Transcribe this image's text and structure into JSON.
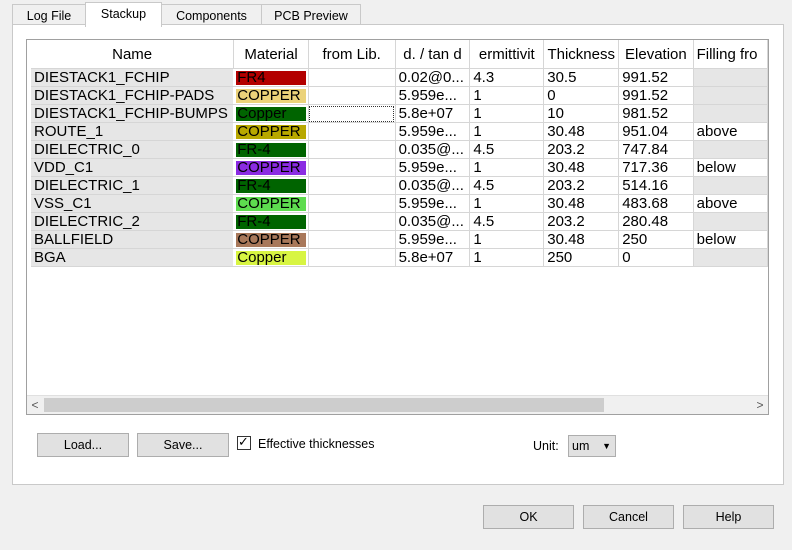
{
  "tabs": [
    {
      "label": "Log File",
      "active": false
    },
    {
      "label": "Stackup",
      "active": true
    },
    {
      "label": "Components",
      "active": false
    },
    {
      "label": "PCB Preview",
      "active": false
    }
  ],
  "grid": {
    "columns": [
      "Name",
      "Material",
      "from Lib.",
      "d. / tan d",
      "ermittivit",
      "Thickness",
      "Elevation",
      "Filling fro"
    ],
    "rows": [
      {
        "name": "DIESTACK1_FCHIP",
        "material": "FR4",
        "material_bg": "#b30000",
        "material_fg": "#000000",
        "lib": "",
        "d_tan": "0.02@0...",
        "perm": "4.3",
        "thickness": "30.5",
        "elevation": "991.52",
        "filling": ""
      },
      {
        "name": "DIESTACK1_FCHIP-PADS",
        "material": "COPPER",
        "material_bg": "#ebd27a",
        "material_fg": "#000000",
        "lib": "",
        "d_tan": "5.959e...",
        "perm": "1",
        "thickness": "0",
        "elevation": "991.52",
        "filling": ""
      },
      {
        "name": "DIESTACK1_FCHIP-BUMPS",
        "material": "Copper",
        "material_bg": "#006400",
        "material_fg": "#000000",
        "lib": "",
        "d_tan": "5.8e+07",
        "perm": "1",
        "thickness": "10",
        "elevation": "981.52",
        "filling": ""
      },
      {
        "name": "ROUTE_1",
        "material": "COPPER",
        "material_bg": "#b8a800",
        "material_fg": "#000000",
        "lib": "",
        "d_tan": "5.959e...",
        "perm": "1",
        "thickness": "30.48",
        "elevation": "951.04",
        "filling": "above"
      },
      {
        "name": "DIELECTRIC_0",
        "material": "FR-4",
        "material_bg": "#006400",
        "material_fg": "#000000",
        "lib": "",
        "d_tan": "0.035@...",
        "perm": "4.5",
        "thickness": "203.2",
        "elevation": "747.84",
        "filling": ""
      },
      {
        "name": "VDD_C1",
        "material": "COPPER",
        "material_bg": "#8a2be2",
        "material_fg": "#000000",
        "lib": "",
        "d_tan": "5.959e...",
        "perm": "1",
        "thickness": "30.48",
        "elevation": "717.36",
        "filling": "below"
      },
      {
        "name": "DIELECTRIC_1",
        "material": "FR-4",
        "material_bg": "#006400",
        "material_fg": "#000000",
        "lib": "",
        "d_tan": "0.035@...",
        "perm": "4.5",
        "thickness": "203.2",
        "elevation": "514.16",
        "filling": ""
      },
      {
        "name": "VSS_C1",
        "material": "COPPER",
        "material_bg": "#5edc4f",
        "material_fg": "#000000",
        "lib": "",
        "d_tan": "5.959e...",
        "perm": "1",
        "thickness": "30.48",
        "elevation": "483.68",
        "filling": "above"
      },
      {
        "name": "DIELECTRIC_2",
        "material": "FR-4",
        "material_bg": "#006400",
        "material_fg": "#000000",
        "lib": "",
        "d_tan": "0.035@...",
        "perm": "4.5",
        "thickness": "203.2",
        "elevation": "280.48",
        "filling": ""
      },
      {
        "name": "BALLFIELD",
        "material": "COPPER",
        "material_bg": "#a8785a",
        "material_fg": "#000000",
        "lib": "",
        "d_tan": "5.959e...",
        "perm": "1",
        "thickness": "30.48",
        "elevation": "250",
        "filling": "below"
      },
      {
        "name": "BGA",
        "material": "Copper",
        "material_bg": "#d8f542",
        "material_fg": "#000000",
        "lib": "",
        "d_tan": "5.8e+07",
        "perm": "1",
        "thickness": "250",
        "elevation": "0",
        "filling": ""
      }
    ]
  },
  "scroll": {
    "left_icon": "chevron-left-icon",
    "right_icon": "chevron-right-icon",
    "left_glyph": "<",
    "right_glyph": ">"
  },
  "controls": {
    "load_label": "Load...",
    "save_label": "Save...",
    "effective_thickness_label": "Effective thicknesses",
    "effective_thickness_checked": true,
    "check_glyph": "✓",
    "unit_label": "Unit:",
    "unit_value": "um",
    "caret_glyph": "▼"
  },
  "dialog_buttons": {
    "ok": "OK",
    "cancel": "Cancel",
    "help": "Help"
  }
}
